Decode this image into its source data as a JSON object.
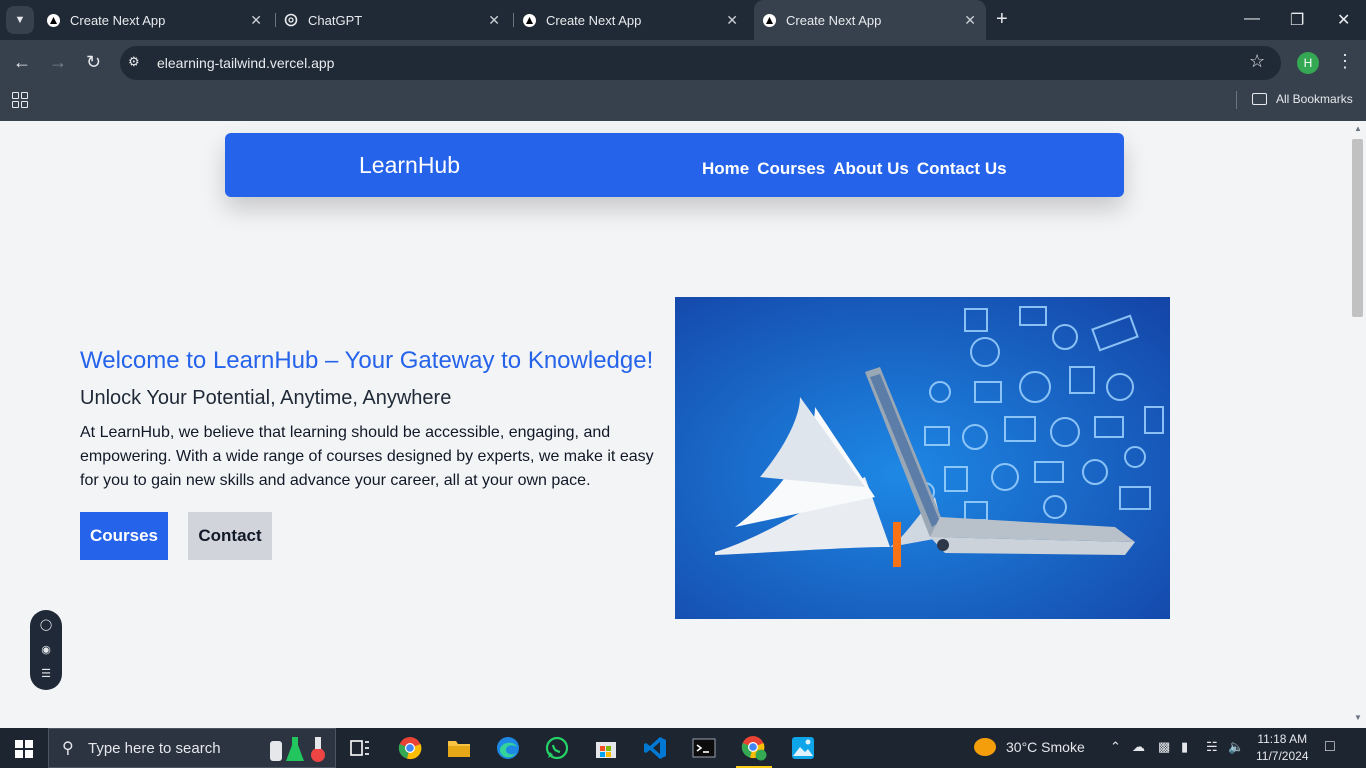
{
  "browser": {
    "tabs": [
      {
        "title": "Create Next App",
        "active": false
      },
      {
        "title": "ChatGPT",
        "active": false
      },
      {
        "title": "Create Next App",
        "active": false
      },
      {
        "title": "Create Next App",
        "active": true
      }
    ],
    "url": "elearning-tailwind.vercel.app",
    "profile_initial": "H",
    "bookmarks_label": "All Bookmarks"
  },
  "page": {
    "brand": "LearnHub",
    "nav": [
      "Home",
      "Courses",
      "About Us",
      "Contact Us"
    ],
    "hero": {
      "title": "Welcome to LearnHub – Your Gateway to Knowledge!",
      "subtitle": "Unlock Your Potential, Anytime, Anywhere",
      "body": "At LearnHub, we believe that learning should be accessible, engaging, and empowering. With a wide range of courses designed by experts, we make it easy for you to gain new skills and advance your career, all at your own pace.",
      "primary_button": "Courses",
      "secondary_button": "Contact"
    },
    "accent_color": "#2563eb"
  },
  "taskbar": {
    "search_placeholder": "Type here to search",
    "weather": "30°C  Smoke",
    "time": "11:18 AM",
    "date": "11/7/2024"
  }
}
